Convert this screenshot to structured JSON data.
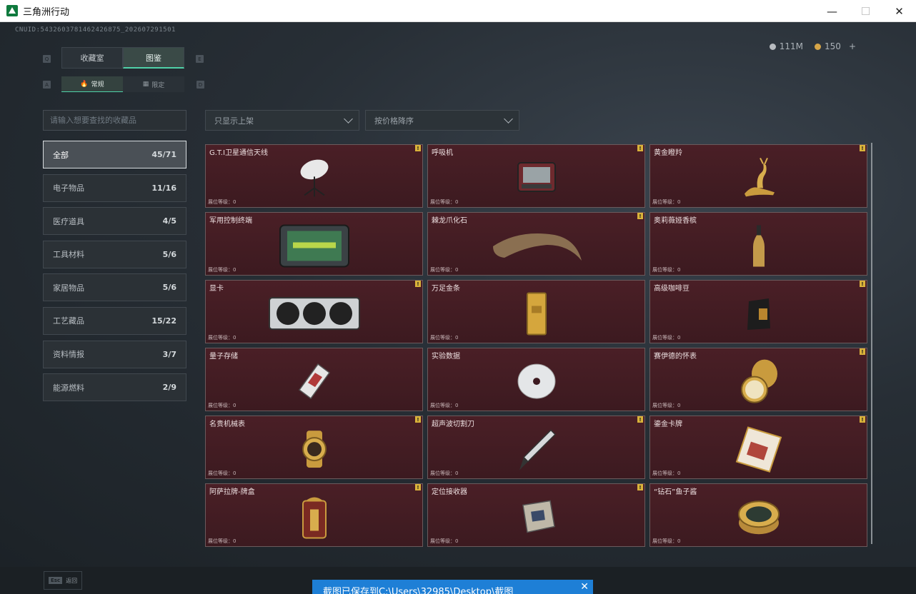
{
  "window": {
    "title": "三角洲行动",
    "minimize": "—",
    "maximize": "☐",
    "close": "✕"
  },
  "header": {
    "uid": "CNUID:5432603781462426875_202607291501",
    "currency": [
      {
        "icon": "silver-coin-icon",
        "value": "111M",
        "color": "#b8bcc0"
      },
      {
        "icon": "gold-coin-icon",
        "value": "150",
        "color": "#d6a548"
      }
    ],
    "add_label": "+"
  },
  "keys": {
    "q": "Q",
    "e": "E",
    "a": "A",
    "d": "D"
  },
  "tabs": [
    {
      "label": "收藏室",
      "active": false
    },
    {
      "label": "图鉴",
      "active": true
    }
  ],
  "subtabs": [
    {
      "label": "常规",
      "icon": "flame-icon",
      "active": true
    },
    {
      "label": "限定",
      "icon": "limited-icon",
      "active": false
    }
  ],
  "search": {
    "placeholder": "请输入想要查找的收藏品"
  },
  "filters": [
    {
      "label": "只显示上架"
    },
    {
      "label": "按价格降序"
    }
  ],
  "categories": [
    {
      "label": "全部",
      "count": "45/71",
      "active": true
    },
    {
      "label": "电子物品",
      "count": "11/16"
    },
    {
      "label": "医疗道具",
      "count": "4/5"
    },
    {
      "label": "工具材料",
      "count": "5/6"
    },
    {
      "label": "家居物品",
      "count": "5/6"
    },
    {
      "label": "工艺藏品",
      "count": "15/22"
    },
    {
      "label": "资料情报",
      "count": "3/7"
    },
    {
      "label": "能源燃料",
      "count": "2/9"
    }
  ],
  "items": [
    {
      "name": "G.T.I卫星通信天线",
      "level": "展位等级：0",
      "badge": "!",
      "icon": "satellite-dish-icon"
    },
    {
      "name": "呼吸机",
      "level": "展位等级：0",
      "badge": "!",
      "icon": "ventilator-icon"
    },
    {
      "name": "黄金瞪羚",
      "level": "展位等级：0",
      "badge": "!",
      "icon": "golden-gazelle-icon"
    },
    {
      "name": "军用控制终端",
      "level": "展位等级：0",
      "badge": "",
      "icon": "military-terminal-icon"
    },
    {
      "name": "棘龙爪化石",
      "level": "展位等级：0",
      "badge": "!",
      "icon": "claw-fossil-icon"
    },
    {
      "name": "奥莉薇娅香槟",
      "level": "展位等级：0",
      "badge": "",
      "icon": "champagne-icon"
    },
    {
      "name": "显卡",
      "level": "展位等级：0",
      "badge": "!",
      "icon": "graphics-card-icon"
    },
    {
      "name": "万足金条",
      "level": "展位等级：0",
      "badge": "",
      "icon": "gold-bar-icon"
    },
    {
      "name": "高级咖啡豆",
      "level": "展位等级：0",
      "badge": "!",
      "icon": "coffee-bag-icon"
    },
    {
      "name": "量子存储",
      "level": "展位等级：0",
      "badge": "",
      "icon": "quantum-storage-icon"
    },
    {
      "name": "实验数据",
      "level": "展位等级：0",
      "badge": "",
      "icon": "data-disc-icon"
    },
    {
      "name": "赛伊德的怀表",
      "level": "展位等级：0",
      "badge": "!",
      "icon": "pocket-watch-icon"
    },
    {
      "name": "名贵机械表",
      "level": "展位等级：0",
      "badge": "!",
      "icon": "luxury-watch-icon"
    },
    {
      "name": "超声波切割刀",
      "level": "展位等级：0",
      "badge": "!",
      "icon": "ultrasonic-cutter-icon"
    },
    {
      "name": "鎏金卡牌",
      "level": "展位等级：0",
      "badge": "!",
      "icon": "gilded-card-icon"
    },
    {
      "name": "阿萨拉牌-牌盒",
      "level": "展位等级：0",
      "badge": "!",
      "icon": "card-box-icon"
    },
    {
      "name": "定位接收器",
      "level": "展位等级：0",
      "badge": "!",
      "icon": "gps-receiver-icon"
    },
    {
      "name": "“钻石”鱼子酱",
      "level": "展位等级：0",
      "badge": "",
      "icon": "caviar-tin-icon"
    }
  ],
  "footer": {
    "esc_key": "Esc",
    "esc_label": "返回",
    "toast": "截图已保存到C:\\Users\\32985\\Desktop\\截图",
    "toast_close": "✕"
  },
  "colors": {
    "accent": "#4fd1a8",
    "card_bg": "#4a1f26",
    "badge": "#d9b23a",
    "toast": "#1e7fd6"
  }
}
